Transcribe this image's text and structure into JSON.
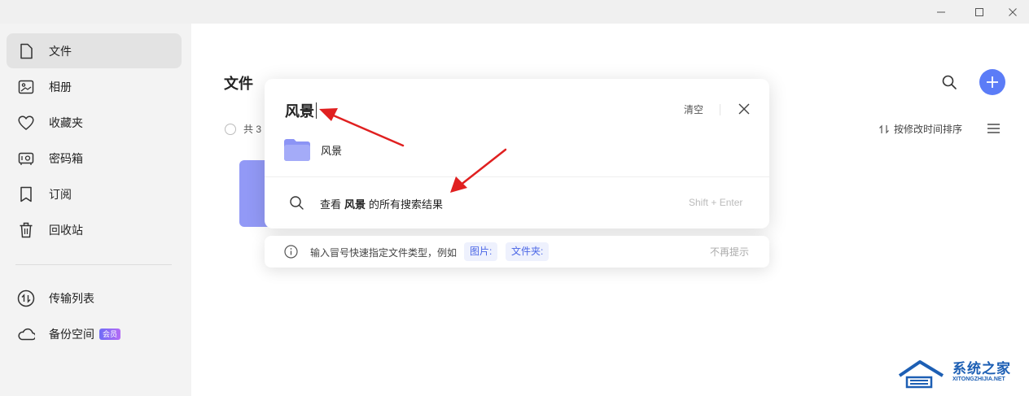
{
  "sidebar": {
    "items": [
      {
        "label": "文件",
        "icon": "file-icon",
        "active": true
      },
      {
        "label": "相册",
        "icon": "album-icon"
      },
      {
        "label": "收藏夹",
        "icon": "heart-icon"
      },
      {
        "label": "密码箱",
        "icon": "safe-icon"
      },
      {
        "label": "订阅",
        "icon": "bookmark-icon"
      },
      {
        "label": "回收站",
        "icon": "trash-icon"
      }
    ],
    "bottom_items": [
      {
        "label": "传输列表",
        "icon": "transfer-icon"
      },
      {
        "label": "备份空间",
        "icon": "cloud-icon",
        "badge": "会员"
      }
    ]
  },
  "main": {
    "title": "文件",
    "count_text": "共 3",
    "sort_label": "按修改时间排序"
  },
  "search_popup": {
    "query": "风景",
    "clear_label": "清空",
    "result_name": "风景",
    "view_all_prefix": "查看",
    "view_all_keyword": "风景",
    "view_all_suffix": "的所有搜索结果",
    "shortcut": "Shift + Enter"
  },
  "tip_bar": {
    "text": "输入冒号快速指定文件类型，例如",
    "chips": [
      "图片:",
      "文件夹:"
    ],
    "dismiss_label": "不再提示"
  },
  "watermark": {
    "title": "系统之家",
    "subtitle": "XITONGZHIJIA.NET"
  },
  "colors": {
    "accent": "#5b7cf7",
    "annotation": "#e02020",
    "sidebar_bg": "#f3f3f3",
    "folder": "#8c94f5"
  }
}
